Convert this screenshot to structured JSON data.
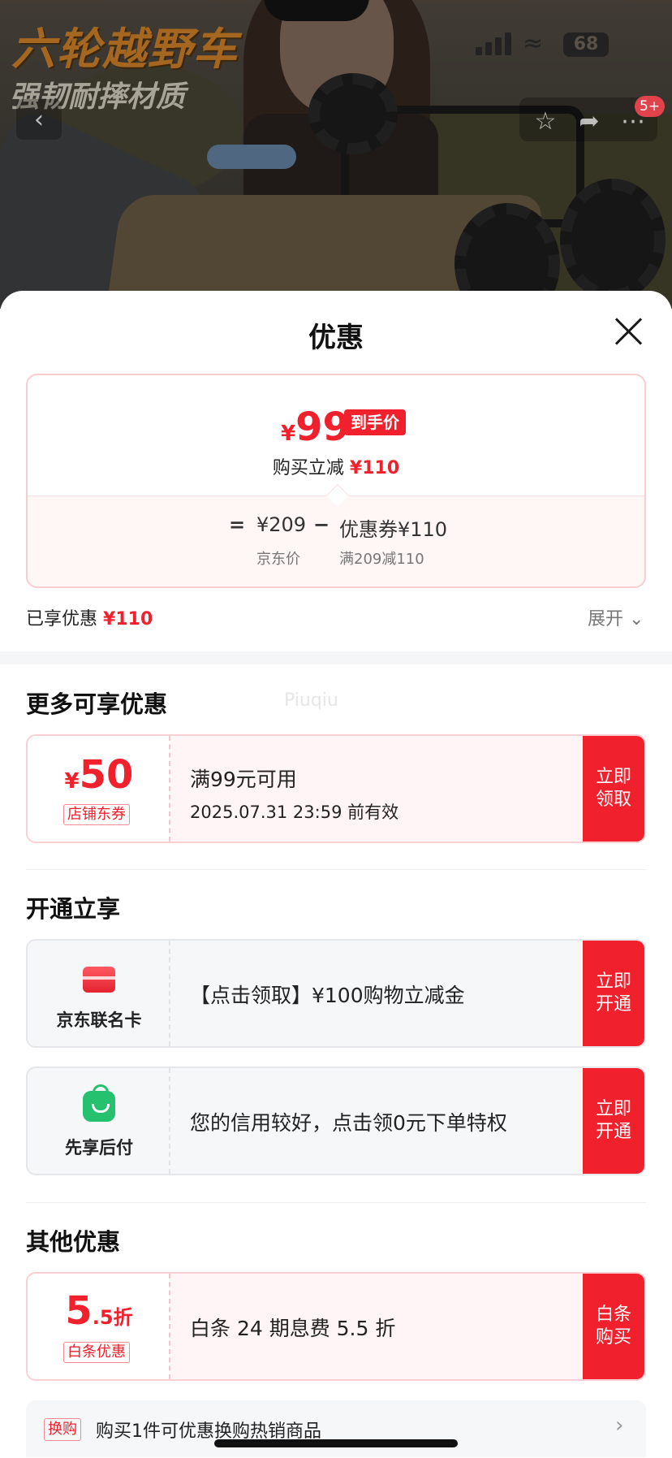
{
  "background": {
    "promo_line_1": "六轮越野车",
    "promo_line_2": "强韧耐摔材质",
    "status_time": "",
    "status_back_app": "",
    "battery": "68",
    "cart_badge": "5+"
  },
  "sheet": {
    "title": "优惠",
    "price": {
      "currency": "¥",
      "final": "99",
      "final_tag": "到手价",
      "reduce_label": "购买立减",
      "reduce_amount": "¥110",
      "eq": "=",
      "jd_price": "¥209",
      "minus": "−",
      "coupon_part": "优惠券¥110",
      "jd_price_label": "京东价",
      "coupon_rule": "满209减110"
    },
    "enjoyed_label": "已享优惠",
    "enjoyed_amount": "¥110",
    "expand_label": "展开",
    "expand_icon": "chevron-down-icon"
  },
  "more_offers": {
    "title": "更多可享优惠",
    "watermark": "Piuqiu",
    "coupon": {
      "currency": "¥",
      "amount": "50",
      "tag": "店铺东券",
      "condition": "满99元可用",
      "validity": "2025.07.31 23:59 前有效",
      "action": "立即领取"
    }
  },
  "open_offers": {
    "title": "开通立享",
    "items": [
      {
        "icon": "credit-card-icon",
        "name": "京东联名卡",
        "desc": "【点击领取】¥100购物立减金",
        "action": "立即开通"
      },
      {
        "icon": "shopping-bag-icon",
        "name": "先享后付",
        "desc": "您的信用较好，点击领0元下单特权",
        "action": "立即开通"
      }
    ]
  },
  "other_offers": {
    "title": "其他优惠",
    "baitiao": {
      "big": "5",
      "small": ".5折",
      "tag": "白条优惠",
      "desc": "白条 24 期息费 5.5 折",
      "action": "白条购买"
    },
    "swap": {
      "tag": "换购",
      "text": "购买1件可优惠换购热销商品",
      "arrow": "›"
    }
  },
  "colors": {
    "accent": "#f0202c",
    "border_pink": "#f9cfd3",
    "bag_green": "#25c16f"
  }
}
